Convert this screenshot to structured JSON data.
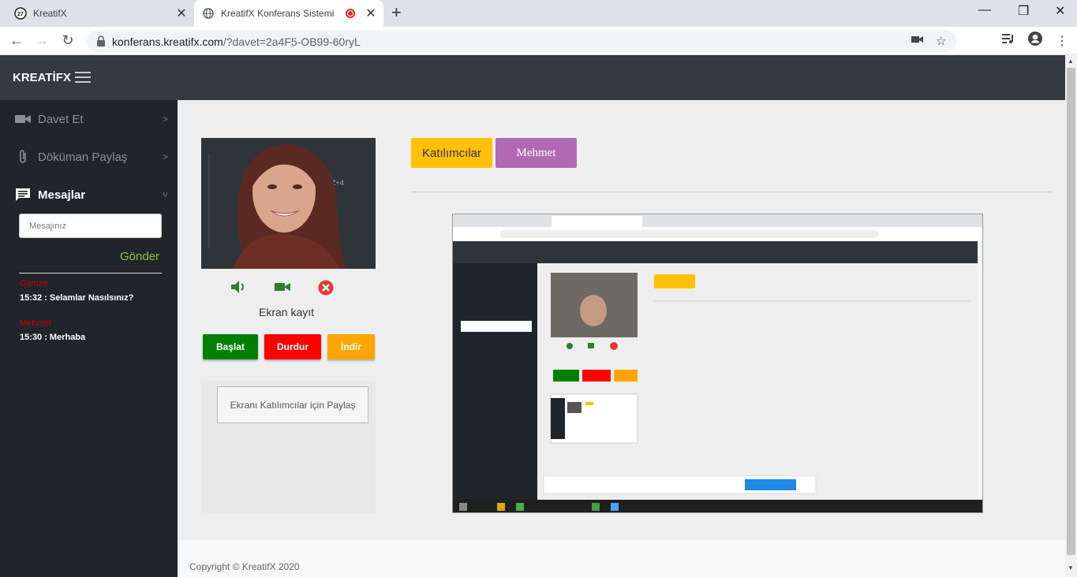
{
  "browser": {
    "tabs": [
      {
        "title": "KreatifX"
      },
      {
        "title": "KreatifX Konferans Sistemi"
      }
    ],
    "url_host": "konferans.kreatifx.com",
    "url_path": "/?davet=2a4F5-OB99-60ryL"
  },
  "app": {
    "brand": "KREATİFX"
  },
  "sidebar": {
    "items": [
      {
        "label": "Davet Et",
        "icon": "video-camera-icon"
      },
      {
        "label": "Döküman Paylaş",
        "icon": "paperclip-icon"
      },
      {
        "label": "Mesajlar",
        "icon": "chat-icon"
      }
    ],
    "message_placeholder": "Mesajınız",
    "send_label": "Gönder",
    "messages": [
      {
        "name": "Gamze",
        "text": "15:32 : Selamlar Nasılsınız?"
      },
      {
        "name": "Mehmet",
        "text": "15:30 : Merhaba"
      }
    ]
  },
  "local_video": {
    "controls": [
      "speaker-icon",
      "camera-icon",
      "hangup-icon"
    ],
    "record_label": "Ekran kayıt",
    "start_label": "Başlat",
    "stop_label": "Durdur",
    "download_label": "İndir",
    "share_label": "Ekranı Katılımcılar için Paylaş"
  },
  "participants": {
    "participants_label": "Katılımcılar",
    "active_label": "Mehmet"
  },
  "footer": {
    "copyright": "Copyright © KreatifX 2020"
  },
  "colors": {
    "topnav": "#343a40",
    "sidebar": "#212529",
    "start": "#008000",
    "stop": "#ff0000",
    "download": "#ffa500",
    "participants": "#ffc107",
    "active_participant": "#b06ab3",
    "send": "#8bc34a"
  }
}
